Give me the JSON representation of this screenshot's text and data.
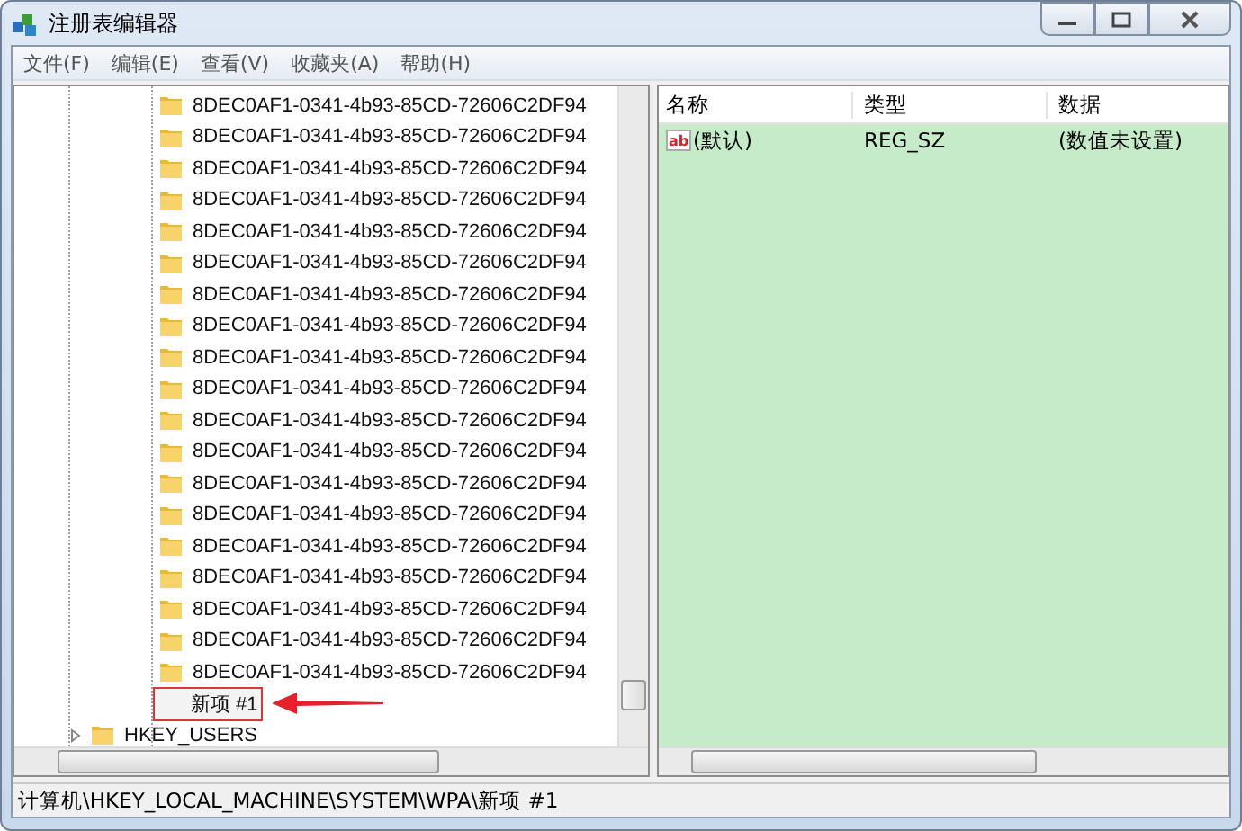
{
  "window": {
    "title": "注册表编辑器"
  },
  "menu": [
    "文件(F)",
    "编辑(E)",
    "查看(V)",
    "收藏夹(A)",
    "帮助(H)"
  ],
  "tree": {
    "items": [
      {
        "label": "8DEC0AF1-0341-4b93-85CD-72606C2DF94",
        "selected": false
      },
      {
        "label": "8DEC0AF1-0341-4b93-85CD-72606C2DF94",
        "selected": false
      },
      {
        "label": "8DEC0AF1-0341-4b93-85CD-72606C2DF94",
        "selected": false
      },
      {
        "label": "8DEC0AF1-0341-4b93-85CD-72606C2DF94",
        "selected": false
      },
      {
        "label": "8DEC0AF1-0341-4b93-85CD-72606C2DF94",
        "selected": false
      },
      {
        "label": "8DEC0AF1-0341-4b93-85CD-72606C2DF94",
        "selected": false
      },
      {
        "label": "8DEC0AF1-0341-4b93-85CD-72606C2DF94",
        "selected": false
      },
      {
        "label": "8DEC0AF1-0341-4b93-85CD-72606C2DF94",
        "selected": false
      },
      {
        "label": "8DEC0AF1-0341-4b93-85CD-72606C2DF94",
        "selected": false
      },
      {
        "label": "8DEC0AF1-0341-4b93-85CD-72606C2DF94",
        "selected": false
      },
      {
        "label": "8DEC0AF1-0341-4b93-85CD-72606C2DF94",
        "selected": false
      },
      {
        "label": "8DEC0AF1-0341-4b93-85CD-72606C2DF94",
        "selected": false
      },
      {
        "label": "8DEC0AF1-0341-4b93-85CD-72606C2DF94",
        "selected": false
      },
      {
        "label": "8DEC0AF1-0341-4b93-85CD-72606C2DF94",
        "selected": false
      },
      {
        "label": "8DEC0AF1-0341-4b93-85CD-72606C2DF94",
        "selected": false
      },
      {
        "label": "8DEC0AF1-0341-4b93-85CD-72606C2DF94",
        "selected": false
      },
      {
        "label": "8DEC0AF1-0341-4b93-85CD-72606C2DF94",
        "selected": false
      },
      {
        "label": "8DEC0AF1-0341-4b93-85CD-72606C2DF94",
        "selected": false
      },
      {
        "label": "8DEC0AF1-0341-4b93-85CD-72606C2DF94",
        "selected": false
      },
      {
        "label": "新项 #1",
        "selected": true
      }
    ],
    "root_items": [
      {
        "label": "HKEY_USERS",
        "expanded": false
      }
    ]
  },
  "values": {
    "columns": [
      "名称",
      "类型",
      "数据"
    ],
    "rows": [
      {
        "icon": "ab",
        "name": "(默认)",
        "type": "REG_SZ",
        "data": "(数值未设置)"
      }
    ]
  },
  "status_bar": "计算机\\HKEY_LOCAL_MACHINE\\SYSTEM\\WPA\\新项 #1"
}
